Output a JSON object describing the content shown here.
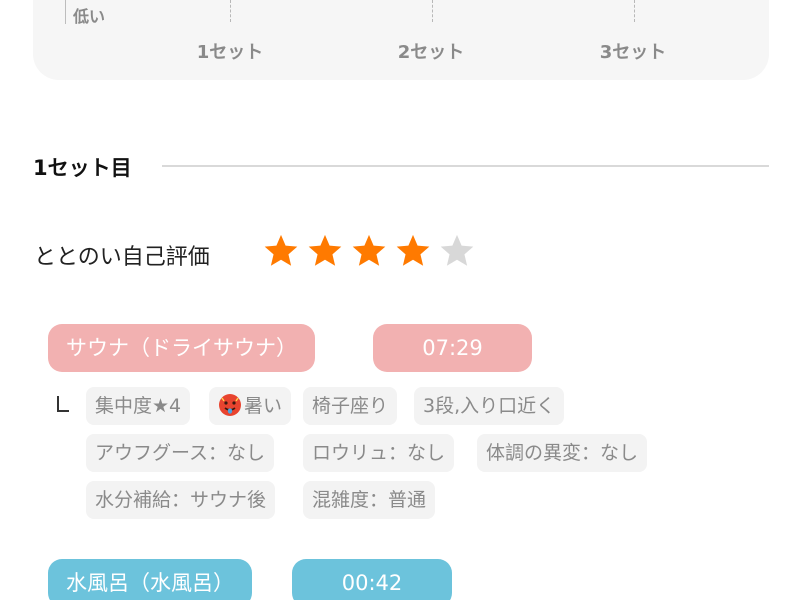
{
  "chart": {
    "y_low_label": "低い",
    "x_labels": [
      "1セット",
      "2セット",
      "3セット"
    ]
  },
  "set1": {
    "section_title": "1セット目",
    "rating_label": "ととのい自己評価",
    "rating": {
      "value": 4,
      "max": 5,
      "filled_color": "#ff7a00",
      "empty_color": "#d8d8d8"
    },
    "sauna": {
      "label": "サウナ（ドライサウナ）",
      "time": "07:29",
      "color": "#f2b1b1"
    },
    "tags": {
      "t1": "集中度★4",
      "t2": "暑い",
      "t2_icon": "hot-face-icon",
      "t3": "椅子座り",
      "t4": "3段,入り口近く",
      "t5": "アウフグース：なし",
      "t6": "ロウリュ：なし",
      "t7": "体調の異変：なし",
      "t8": "水分補給：サウナ後",
      "t9": "混雑度：普通"
    },
    "water": {
      "label": "水風呂（水風呂）",
      "time": "00:42",
      "color": "#6cc3dc"
    }
  }
}
